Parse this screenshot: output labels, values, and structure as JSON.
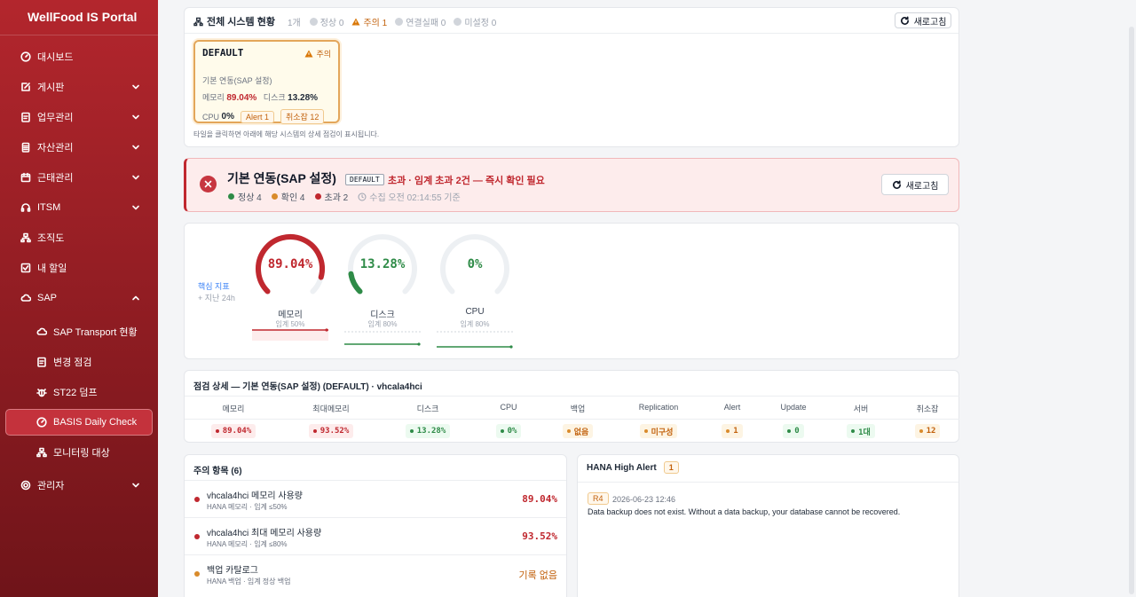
{
  "app": {
    "title": "WellFood IS Portal"
  },
  "sidebar": {
    "items": [
      {
        "label": "대시보드"
      },
      {
        "label": "게시판"
      },
      {
        "label": "업무관리"
      },
      {
        "label": "자산관리"
      },
      {
        "label": "근태관리"
      },
      {
        "label": "ITSM"
      },
      {
        "label": "조직도"
      },
      {
        "label": "내 할일"
      },
      {
        "label": "SAP"
      },
      {
        "label": "SAP Transport 현황"
      },
      {
        "label": "변경 점검"
      },
      {
        "label": "ST22 덤프"
      },
      {
        "label": "BASIS Daily Check"
      },
      {
        "label": "모니터링 대상"
      },
      {
        "label": "관리자"
      }
    ]
  },
  "overview": {
    "title": "전체 시스템 현황",
    "count": "1개",
    "normal": "정상 0",
    "warning": "주의 1",
    "conn_fail": "연결실패 0",
    "unset": "미설정 0",
    "refresh": "새로고침",
    "hint": "타일을 클릭하면 아래에 해당 시스템의 상세 점검이 표시됩니다.",
    "tile": {
      "name": "DEFAULT",
      "badge": "주의",
      "sub": "기본 연동(SAP 설정)",
      "mem_label": "메모리",
      "mem_value": "89.04%",
      "disk_label": "디스크",
      "disk_value": "13.28%",
      "cpu_label": "CPU",
      "cpu_value": "0%",
      "alert_chip": "Alert 1",
      "cancel_chip": "취소잡 12"
    }
  },
  "banner": {
    "title": "기본 연동(SAP 설정)",
    "tag": "DEFAULT",
    "message": "초과 · 임계 초과 2건 — 즉시 확인 필요",
    "normal": "정상 4",
    "check": "확인 4",
    "exceed": "초과 2",
    "collected": "수집 오전 02:14:55 기준",
    "refresh": "새로고침"
  },
  "kpi": {
    "label": "핵심 지표",
    "sub": "+ 지난 24h",
    "gauges": [
      {
        "value_text": "89.04%",
        "value": 89.04,
        "label": "메모리",
        "threshold": "임계 50%",
        "color": "#c0282f"
      },
      {
        "value_text": "13.28%",
        "value": 13.28,
        "label": "디스크",
        "threshold": "임계 80%",
        "color": "#2e8b47"
      },
      {
        "value_text": "0%",
        "value": 0,
        "label": "CPU",
        "threshold": "임계 80%",
        "color": "#2e8b47"
      }
    ]
  },
  "detail": {
    "title": "점검 상세 — 기본 연동(SAP 설정) (DEFAULT) · vhcala4hci",
    "columns": [
      "메모리",
      "최대메모리",
      "디스크",
      "CPU",
      "백업",
      "Replication",
      "Alert",
      "Update",
      "서버",
      "취소잡"
    ],
    "values": [
      "89.04%",
      "93.52%",
      "13.28%",
      "0%",
      "없음",
      "미구성",
      "1",
      "0",
      "1대",
      "12"
    ]
  },
  "issues": {
    "title": "주의 항목 (6)",
    "items": [
      {
        "name": "vhcala4hci 메모리 사용량",
        "sub": "HANA 메모리 · 임계 ≤50%",
        "value": "89.04%"
      },
      {
        "name": "vhcala4hci 최대 메모리 사용량",
        "sub": "HANA 메모리 · 임계 ≤80%",
        "value": "93.52%"
      },
      {
        "name": "백업 카탈로그",
        "sub": "HANA 백업 · 임계 정상 백업",
        "value": "기록 없음"
      }
    ]
  },
  "hana_alert": {
    "title": "HANA High Alert",
    "count": "1",
    "rating": "R4",
    "time": "2026-06-23 12:46",
    "message": "Data backup does not exist. Without a data backup, your database cannot be recovered."
  }
}
